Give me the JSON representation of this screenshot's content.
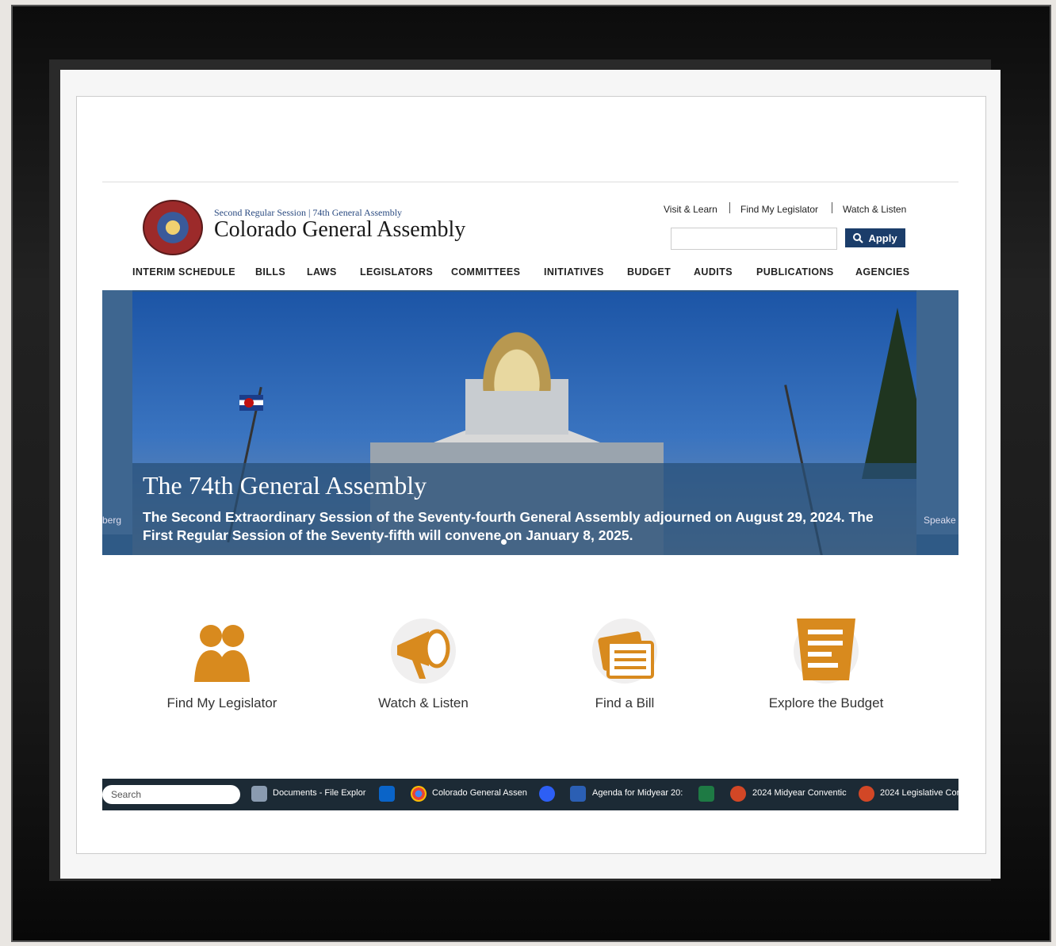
{
  "header": {
    "session": "Second Regular Session | 74th General Assembly",
    "title": "Colorado General Assembly"
  },
  "utility_links": [
    "Visit & Learn",
    "Find My Legislator",
    "Watch & Listen"
  ],
  "search": {
    "placeholder": "",
    "button_label": "Apply"
  },
  "nav": [
    "INTERIM SCHEDULE",
    "BILLS",
    "LAWS",
    "LEGISLATORS",
    "COMMITTEES",
    "INITIATIVES",
    "BUDGET",
    "AUDITS",
    "PUBLICATIONS",
    "AGENCIES"
  ],
  "hero": {
    "title": "The 74th General Assembly",
    "text": "The Second Extraordinary Session of the Seventy-fourth General Assembly adjourned on August 29, 2024. The First Regular Session of the Seventy-fifth will convene on January 8, 2025.",
    "side_left": "berg",
    "side_right": "Speake"
  },
  "tiles": [
    {
      "label": "Find My Legislator",
      "icon": "legislator-icon"
    },
    {
      "label": "Watch & Listen",
      "icon": "megaphone-icon"
    },
    {
      "label": "Find a Bill",
      "icon": "bill-icon"
    },
    {
      "label": "Explore the Budget",
      "icon": "budget-icon"
    }
  ],
  "taskbar": {
    "search": "Search",
    "items": [
      "Documents - File Explor",
      "Colorado General Assen",
      "Agenda for Midyear 20:",
      "2024 Midyear Conventic",
      "2024 Legislative Cor"
    ]
  },
  "colors": {
    "accent": "#d88a1e",
    "nav_blue": "#1b3d6a"
  }
}
